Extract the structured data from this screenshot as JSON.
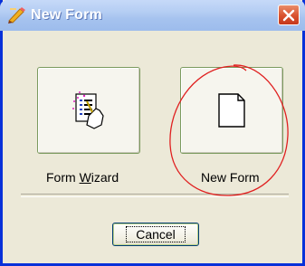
{
  "window": {
    "title": "New Form",
    "title_icon": "form-pencil-icon",
    "close_icon": "close-icon"
  },
  "options": [
    {
      "id": "form-wizard",
      "label_prefix": "Form ",
      "label_access": "W",
      "label_suffix": "izard",
      "icon": "form-wizard-icon"
    },
    {
      "id": "new-form",
      "label_prefix": "New F",
      "label_access": "",
      "label_suffix": "orm",
      "icon": "blank-page-icon"
    }
  ],
  "cancel_button": {
    "label": "Cancel"
  },
  "colors": {
    "title_gradient_top": "#c6d9f8",
    "close_button": "#d9522e",
    "window_face": "#ece9d8",
    "annotation_circle": "#e02020"
  },
  "annotation": {
    "shape": "red-hand-drawn-circle",
    "target": "new-form"
  }
}
